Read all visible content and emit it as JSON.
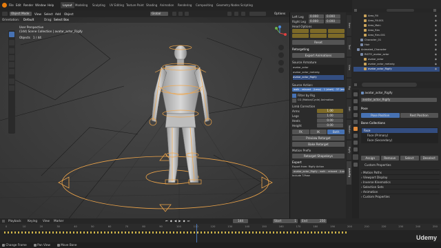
{
  "topbar": {
    "menus": [
      "File",
      "Edit",
      "Render",
      "Window",
      "Help"
    ],
    "workspaces": [
      "Layout",
      "Modeling",
      "Sculpting",
      "UV Editing",
      "Texture Paint",
      "Shading",
      "Animation",
      "Rendering",
      "Compositing",
      "Geometry Nodes",
      "Scripting"
    ],
    "active_workspace": "Layout",
    "scene_label": "Scene",
    "viewlayer_label": "ViewLayer"
  },
  "viewport_header": {
    "mode": "Object Mode",
    "menus": [
      "View",
      "Select",
      "Add",
      "Object"
    ],
    "orientation": "Global",
    "options": "Options"
  },
  "viewport_sub": {
    "orientation_label": "Orientation:",
    "orientation_value": "Default",
    "drag_label": "Drag:",
    "drag_value": "Select Box"
  },
  "overlay_text": {
    "view_name": "User Perspective",
    "collection_path": "(144) Scene Collection | avatar_actor_Rigify",
    "objects_label": "Objects",
    "objects_value": "1 / 44"
  },
  "npanel": {
    "rows_top": [
      {
        "label": "Left Leg",
        "v1": "0.000",
        "v2": "0.000"
      },
      {
        "label": "Right Leg",
        "v1": "0.000",
        "v2": "0.000"
      }
    ],
    "head_options": "Head Options",
    "reset_label": "Reset",
    "retargeting_label": "Retargeting",
    "export_animations": "Export Animations",
    "source_armature_label": "Source Armature",
    "source_items": [
      "avatar_actor",
      "avatar_actor_metarig",
      "avatar_actor_Rigify"
    ],
    "source_action_label": "Source Action:",
    "source_action_value": "walk - relaxed - (Loop) - 1 (start) : 37 (end) - 37 frame(s) (animated)",
    "filter_by_rig": "Filter by Rig",
    "root_motion": "CG (Motion/Cycle) Animation",
    "limb_correction": "Limb Correction",
    "limb_rows": [
      {
        "label": "Arms",
        "value": "1.00"
      },
      {
        "label": "Legs",
        "value": "1.00"
      },
      {
        "label": "Heels",
        "value": "0.00"
      },
      {
        "label": "Height",
        "value": "0.00"
      }
    ],
    "toggle_labels": [
      "FK",
      "IK",
      "Both"
    ],
    "preview_retarget": "Preview Retarget",
    "bake_retarget": "Bake Retarget",
    "motion_prefix": "Motion Prefix",
    "retarget_shape_keys": "Retarget Shapekeys",
    "export_label": "Export",
    "export_from": "Export from: Rigify Action",
    "export_value": "avatar_actor_Rigify - walk - relaxed - (Loop) - 1 (start) : 37 (end) - 37 frame(s) (animated)",
    "include_t_pose": "Include T-Pose"
  },
  "ntabs": [
    "Item",
    "Tool",
    "View",
    "Rig",
    "Edit",
    "Motion",
    "Rigify",
    "AutoRig"
  ],
  "outliner": {
    "items": [
      {
        "label": "Area_Fill",
        "indent": 3
      },
      {
        "label": "Area_Fill.001",
        "indent": 3
      },
      {
        "label": "Area_Main",
        "indent": 3
      },
      {
        "label": "Area_Rim",
        "indent": 3
      },
      {
        "label": "Area_Rim.001",
        "indent": 3
      },
      {
        "label": "Character_01",
        "indent": 2
      },
      {
        "label": "Hair",
        "indent": 2
      },
      {
        "label": "Animated_Character",
        "indent": 1
      },
      {
        "label": "RIGTO_avatar_actor",
        "indent": 2
      },
      {
        "label": "avatar_actor",
        "indent": 3
      },
      {
        "label": "avatar_actor_metarig",
        "indent": 3
      },
      {
        "label": "avatar_actor_Rigify",
        "indent": 3
      }
    ],
    "selected_index": 11
  },
  "props": {
    "object_name": "avatar_actor_Rigify",
    "data_name": "avatar_actor_Rigify",
    "pose_label": "Pose",
    "pose_position": "Pose Position",
    "rest_position": "Rest Position",
    "bone_collections": "Bone Collections",
    "collections": [
      {
        "label": "Face",
        "selected": true
      },
      {
        "label": "Face (Primary)",
        "selected": false
      },
      {
        "label": "Face (Secondary)",
        "selected": false
      }
    ],
    "buttons": [
      "Assign",
      "Remove",
      "Select",
      "Deselect"
    ],
    "custom_properties_inner": "Custom Properties",
    "sections": [
      "Motion Paths",
      "Viewport Display",
      "Inverse Kinematics",
      "Selection Sets",
      "Animation",
      "Custom Properties"
    ]
  },
  "timeline": {
    "menus": [
      "Playback",
      "Keying",
      "View",
      "Marker"
    ],
    "current_frame": "144",
    "start_label": "Start",
    "start_value": "1",
    "end_label": "End",
    "end_value": "250",
    "ticks": [
      "0",
      "10",
      "20",
      "30",
      "40",
      "50",
      "60",
      "70",
      "80",
      "90",
      "100",
      "110",
      "120",
      "130",
      "140",
      "150",
      "160",
      "170",
      "180",
      "190",
      "200",
      "210",
      "220",
      "230",
      "240",
      "250"
    ]
  },
  "status": {
    "items": [
      "Change Frame",
      "Pan View",
      "Move Bone"
    ]
  },
  "watermark": "Udemy",
  "colors": {
    "accent": "#4772b3",
    "orange": "#f0a64a",
    "bg": "#3a3a3a"
  }
}
